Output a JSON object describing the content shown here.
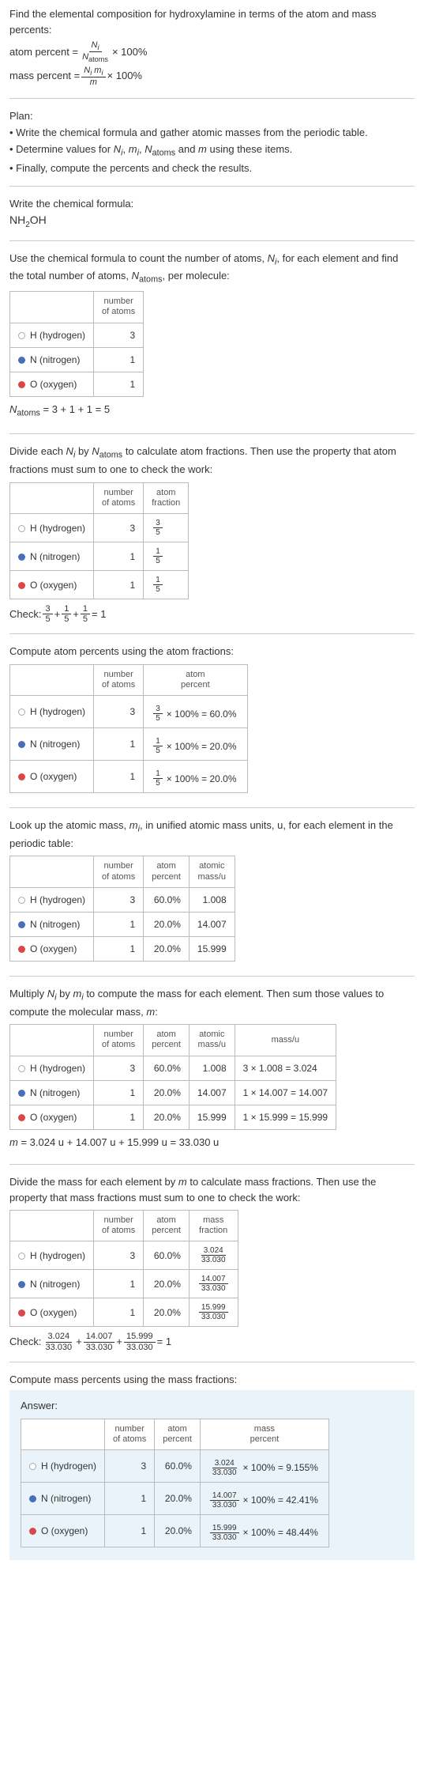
{
  "intro": "Find the elemental composition for hydroxylamine in terms of the atom and mass percents:",
  "atom_percent_label": "atom percent =",
  "atom_percent_frac_num": "N_i",
  "atom_percent_frac_den": "N_atoms",
  "times_100": "× 100%",
  "mass_percent_label": "mass percent =",
  "mass_percent_frac_num": "N_i m_i",
  "mass_percent_frac_den": "m",
  "plan_label": "Plan:",
  "plan_items": [
    "• Write the chemical formula and gather atomic masses from the periodic table.",
    "• Determine values for N_i, m_i, N_atoms and m using these items.",
    "• Finally, compute the percents and check the results."
  ],
  "write_formula_label": "Write the chemical formula:",
  "chem_formula_parts": [
    "NH",
    "2",
    "OH"
  ],
  "count_atoms_text": "Use the chemical formula to count the number of atoms, N_i, for each element and find the total number of atoms, N_atoms, per molecule:",
  "headers": {
    "number_of_atoms": "number\nof atoms",
    "atom_fraction": "atom\nfraction",
    "atom_percent": "atom\npercent",
    "atomic_mass": "atomic\nmass/u",
    "mass_u": "mass/u",
    "mass_fraction": "mass\nfraction",
    "mass_percent": "mass\npercent"
  },
  "elements": {
    "H": {
      "name": "H (hydrogen)",
      "atoms": "3",
      "frac_num": "3",
      "frac_den": "5",
      "percent_calc": "× 100% = 60.0%",
      "percent": "60.0%",
      "mass": "1.008",
      "mass_calc": "3 × 1.008 = 3.024",
      "mass_frac_num": "3.024",
      "mass_frac_den": "33.030",
      "mass_percent_calc": "× 100% = 9.155%"
    },
    "N": {
      "name": "N (nitrogen)",
      "atoms": "1",
      "frac_num": "1",
      "frac_den": "5",
      "percent_calc": "× 100% = 20.0%",
      "percent": "20.0%",
      "mass": "14.007",
      "mass_calc": "1 × 14.007 = 14.007",
      "mass_frac_num": "14.007",
      "mass_frac_den": "33.030",
      "mass_percent_calc": "× 100% = 42.41%"
    },
    "O": {
      "name": "O (oxygen)",
      "atoms": "1",
      "frac_num": "1",
      "frac_den": "5",
      "percent_calc": "× 100% = 20.0%",
      "percent": "20.0%",
      "mass": "15.999",
      "mass_calc": "1 × 15.999 = 15.999",
      "mass_frac_num": "15.999",
      "mass_frac_den": "33.030",
      "mass_percent_calc": "× 100% = 48.44%"
    }
  },
  "n_atoms_eq": "N_atoms = 3 + 1 + 1 = 5",
  "divide_text": "Divide each N_i by N_atoms to calculate atom fractions. Then use the property that atom fractions must sum to one to check the work:",
  "check_label": "Check: ",
  "check_frac_eq": " = 1",
  "check_plus": " + ",
  "compute_atom_pct": "Compute atom percents using the atom fractions:",
  "lookup_mass_text": "Look up the atomic mass, m_i, in unified atomic mass units, u, for each element in the periodic table:",
  "multiply_text": "Multiply N_i by m_i to compute the mass for each element. Then sum those values to compute the molecular mass, m:",
  "m_eq": "m = 3.024 u + 14.007 u + 15.999 u = 33.030 u",
  "divide_mass_text": "Divide the mass for each element by m to calculate mass fractions. Then use the property that mass fractions must sum to one to check the work:",
  "compute_mass_pct": "Compute mass percents using the mass fractions:",
  "answer_label": "Answer:",
  "mass_check_terms": [
    {
      "num": "3.024",
      "den": "33.030"
    },
    {
      "num": "14.007",
      "den": "33.030"
    },
    {
      "num": "15.999",
      "den": "33.030"
    }
  ]
}
